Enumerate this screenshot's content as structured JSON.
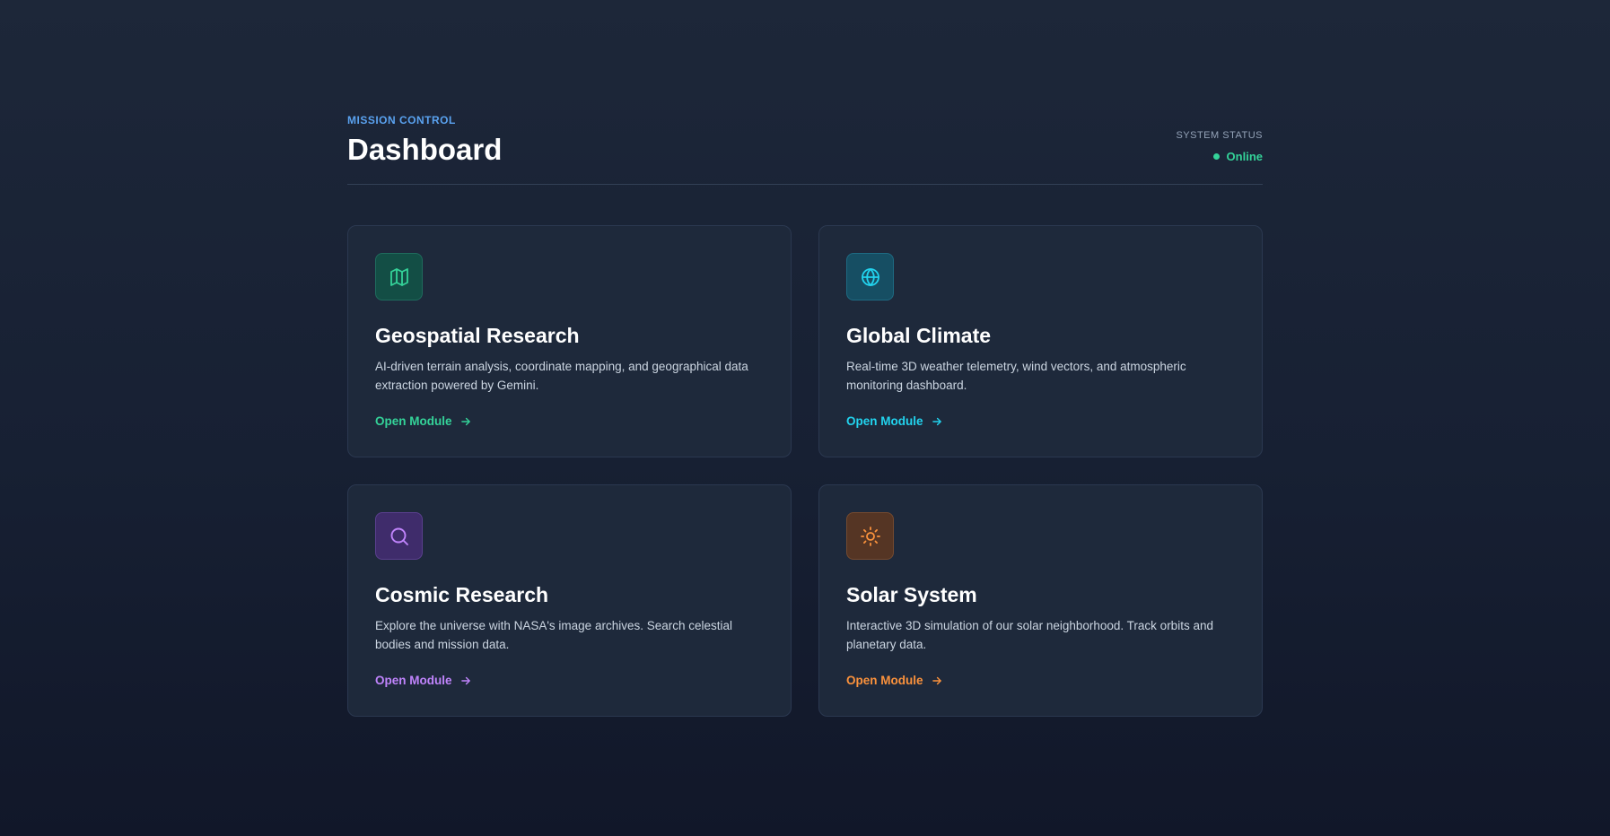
{
  "header": {
    "eyebrow": "MISSION CONTROL",
    "title": "Dashboard",
    "status_label": "SYSTEM STATUS",
    "status_value": "Online",
    "status_color": "#34d399",
    "eyebrow_color": "#5aa2f0"
  },
  "cards": [
    {
      "title": "Geospatial Research",
      "description": "AI-driven terrain analysis, coordinate mapping, and geographical data extraction powered by Gemini.",
      "link_label": "Open Module",
      "icon": "map-icon",
      "accent": "#34d399",
      "icon_bg": "#134e45",
      "icon_border": "#1f6b5d"
    },
    {
      "title": "Global Climate",
      "description": "Real-time 3D weather telemetry, wind vectors, and atmospheric monitoring dashboard.",
      "link_label": "Open Module",
      "icon": "globe-icon",
      "accent": "#22d3ee",
      "icon_bg": "#164e63",
      "icon_border": "#1e6a82"
    },
    {
      "title": "Cosmic Research",
      "description": "Explore the universe with NASA's image archives. Search celestial bodies and mission data.",
      "link_label": "Open Module",
      "icon": "search-icon",
      "accent": "#c084fc",
      "icon_bg": "#3f2c6b",
      "icon_border": "#5a3f8e"
    },
    {
      "title": "Solar System",
      "description": "Interactive 3D simulation of our solar neighborhood. Track orbits and planetary data.",
      "link_label": "Open Module",
      "icon": "sun-icon",
      "accent": "#fb923c",
      "icon_bg": "#553524",
      "icon_border": "#744a30"
    }
  ]
}
